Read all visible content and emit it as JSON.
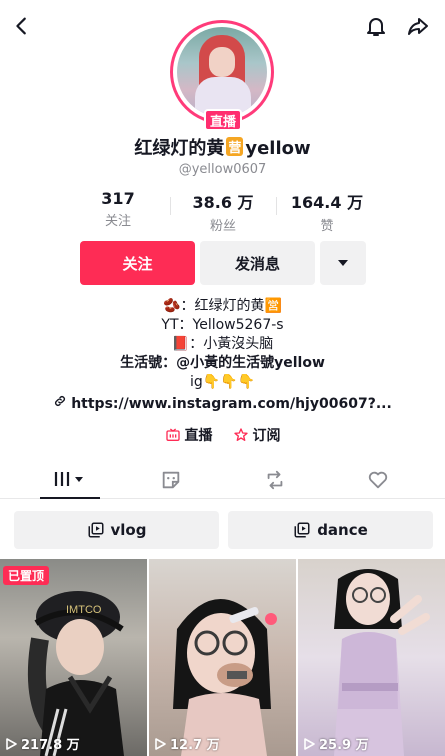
{
  "header": {
    "back_icon": "chevron-left-icon",
    "bell_icon": "bell-icon",
    "share_icon": "share-arrow-icon"
  },
  "profile": {
    "live_badge": "直播",
    "name_prefix": "红绿灯的黄",
    "name_badge": "营",
    "name_suffix": "yellow",
    "handle": "@yellow0607"
  },
  "stats": [
    {
      "value": "317",
      "label": "关注"
    },
    {
      "value": "38.6 万",
      "label": "粉丝"
    },
    {
      "value": "164.4 万",
      "label": "赞"
    }
  ],
  "actions": {
    "follow_label": "关注",
    "message_label": "发消息",
    "more_label": "▾"
  },
  "bio": {
    "line1": "🫘：红绿灯的黄🈺",
    "line2": "YT：Yellow5267-s",
    "line3": "📕：小黃沒头脑",
    "line4": "生活號：@小黃的生活號yellow",
    "line5": "ig👇👇👇"
  },
  "link": {
    "url": "https://www.instagram.com/hjy00607?..."
  },
  "subrow": {
    "live_label": "直播",
    "subscribe_label": "订阅"
  },
  "tabs": {
    "videos": "grid-icon",
    "stickers": "sticker-icon",
    "reposts": "repost-icon",
    "likes": "heart-icon"
  },
  "playlists": [
    {
      "label": "vlog"
    },
    {
      "label": "dance"
    }
  ],
  "videos": [
    {
      "pinned": "已置顶",
      "views": "217.8 万"
    },
    {
      "views": "12.7 万"
    },
    {
      "views": "25.9 万"
    }
  ],
  "colors": {
    "accent": "#fe2c55",
    "live": "#ff2d6f",
    "badge": "#f5a623"
  }
}
